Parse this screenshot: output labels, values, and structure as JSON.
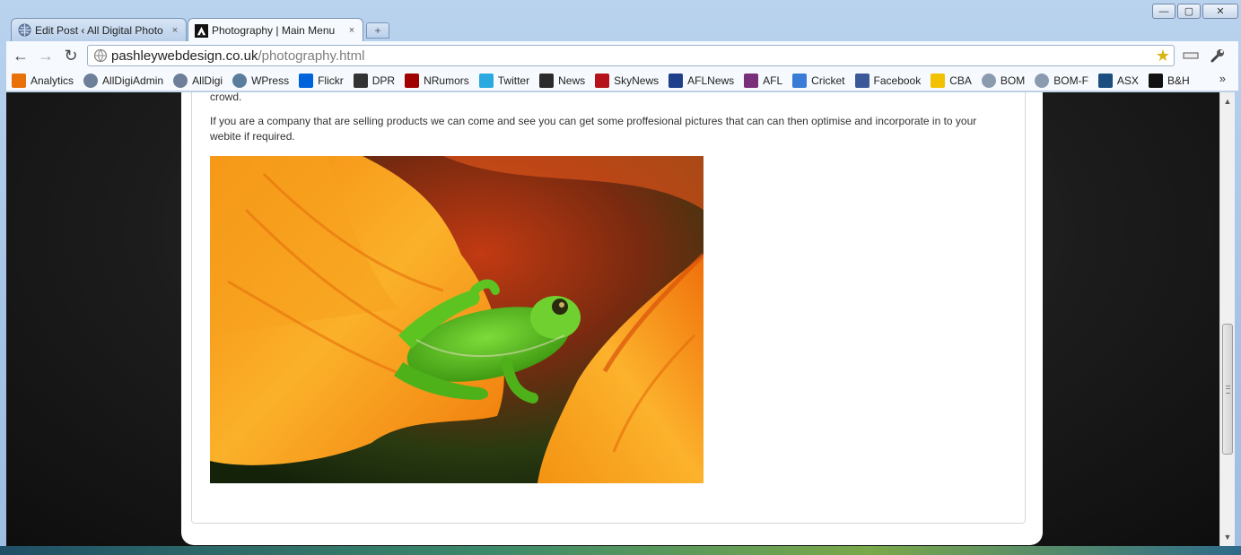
{
  "window": {
    "controls": {
      "minimize": "—",
      "maximize": "▢",
      "close": "✕"
    }
  },
  "tabs": [
    {
      "title": "Edit Post ‹ All Digital Photo",
      "icon": "globe-icon",
      "active": false,
      "close": "×"
    },
    {
      "title": "Photography | Main Menu",
      "icon": "site-logo-icon",
      "active": true,
      "close": "×"
    }
  ],
  "new_tab": "+",
  "toolbar": {
    "back": "←",
    "forward": "→",
    "reload": "↻",
    "url_host": "pashleywebdesign.co.uk",
    "url_path": "/photography.html",
    "star": "★",
    "page_menu": "▭",
    "wrench": "🔧"
  },
  "bookmarks": [
    {
      "label": "Analytics",
      "icon": "analytics-icon",
      "color": "#e8710a"
    },
    {
      "label": "AllDigiAdmin",
      "icon": "globe-icon",
      "color": "#6d7f99"
    },
    {
      "label": "AllDigi",
      "icon": "globe-icon",
      "color": "#6d7f99"
    },
    {
      "label": "WPress",
      "icon": "wordpress-icon",
      "color": "#5b7d9c"
    },
    {
      "label": "Flickr",
      "icon": "flickr-icon",
      "color": "#0063dc"
    },
    {
      "label": "DPR",
      "icon": "dpr-icon",
      "color": "#333333"
    },
    {
      "label": "NRumors",
      "icon": "nrumors-icon",
      "color": "#a00000"
    },
    {
      "label": "Twitter",
      "icon": "twitter-icon",
      "color": "#2aa9e0"
    },
    {
      "label": "News",
      "icon": "news-icon",
      "color": "#2b2b2b"
    },
    {
      "label": "SkyNews",
      "icon": "skynews-icon",
      "color": "#b5121b"
    },
    {
      "label": "AFLNews",
      "icon": "hs-icon",
      "color": "#1e3f8a"
    },
    {
      "label": "AFL",
      "icon": "afl-icon",
      "color": "#7a2f7a"
    },
    {
      "label": "Cricket",
      "icon": "cricket-icon",
      "color": "#3a7bd5"
    },
    {
      "label": "Facebook",
      "icon": "facebook-icon",
      "color": "#3b5998"
    },
    {
      "label": "CBA",
      "icon": "cba-icon",
      "color": "#f2c200"
    },
    {
      "label": "BOM",
      "icon": "bom-icon",
      "color": "#8a9bb0"
    },
    {
      "label": "BOM-F",
      "icon": "bom-icon",
      "color": "#8a9bb0"
    },
    {
      "label": "ASX",
      "icon": "asx-icon",
      "color": "#1c4e80"
    },
    {
      "label": "B&H",
      "icon": "bh-icon",
      "color": "#111111"
    }
  ],
  "bookmarks_more": "»",
  "content": {
    "fragment": "crowd.",
    "paragraph": "If you are a company that are selling products we can come and see you can get some proffesional pictures that can can then optimise and incorporate in to your webite if required."
  },
  "scrollbar": {
    "up": "▲",
    "down": "▼"
  }
}
